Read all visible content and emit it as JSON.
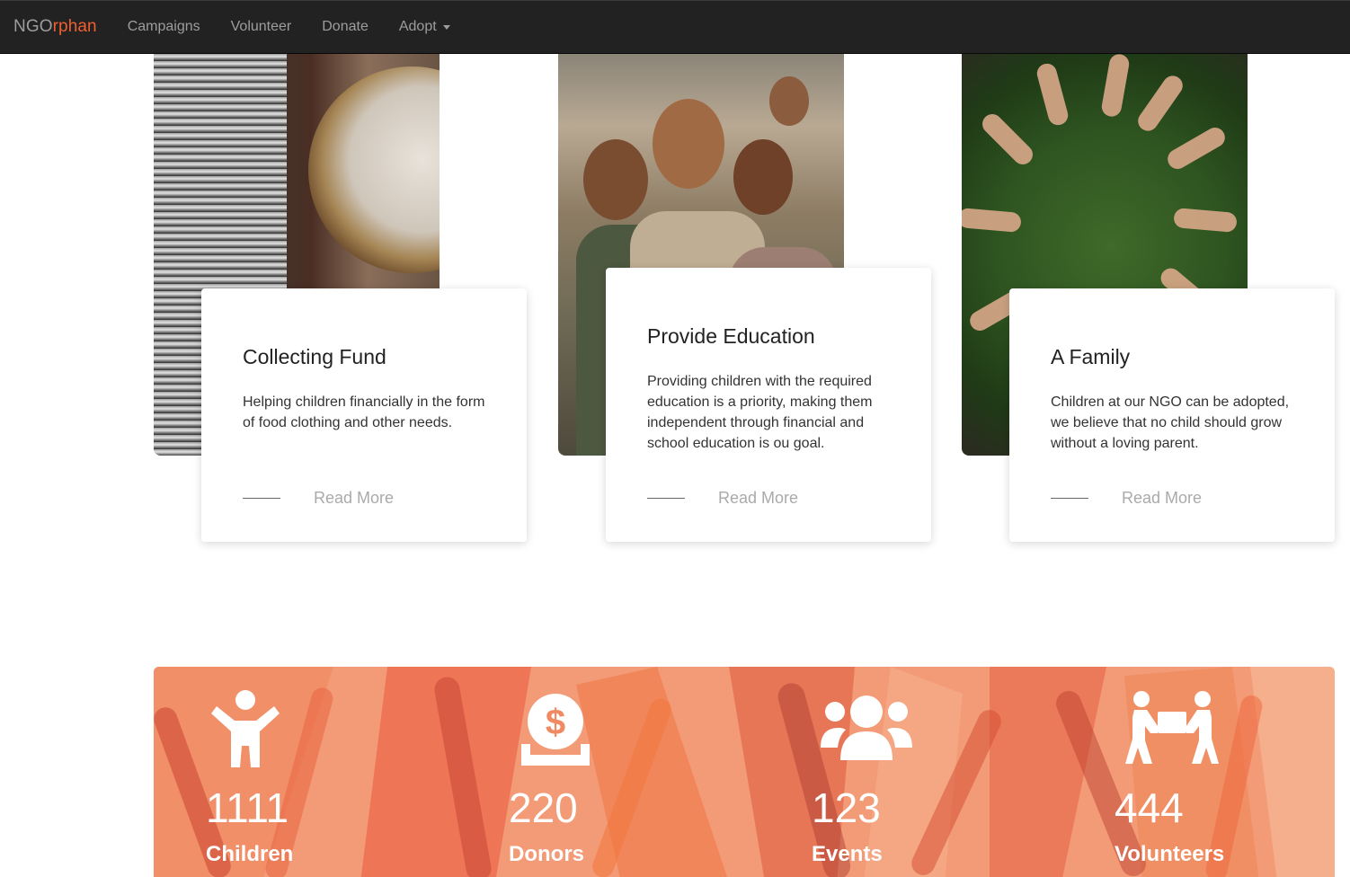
{
  "navbar": {
    "brand_prefix": "NGO",
    "brand_accent": "rphan",
    "links": [
      "Campaigns",
      "Volunteer",
      "Donate",
      "Adopt"
    ]
  },
  "campaigns": [
    {
      "title": "Collecting Fund",
      "text": "Helping children financially in the form of food clothing and other needs.",
      "cta": "Read More",
      "photo": "coins-photo"
    },
    {
      "title": "Provide Education",
      "text": "Providing children with the required education is a priority, making them independent through financial and school education is ou goal.",
      "cta": "Read More",
      "photo": "children-photo"
    },
    {
      "title": "A Family",
      "text": "Children at our NGO can be adopted, we believe that no child should grow without a loving parent.",
      "cta": "Read More",
      "photo": "hands-photo"
    }
  ],
  "stats": [
    {
      "icon": "child-icon",
      "value": "1111",
      "label": "Children"
    },
    {
      "icon": "dollar-coin-icon",
      "value": "220",
      "label": "Donors"
    },
    {
      "icon": "users-group-icon",
      "value": "123",
      "label": "Events"
    },
    {
      "icon": "people-carry-icon",
      "value": "444",
      "label": "Volunteers"
    }
  ],
  "colors": {
    "navbar_bg": "#222222",
    "brand_accent": "#f05f2e",
    "stats_bg": "#f4a07c",
    "read_more": "#aaaaaa"
  }
}
